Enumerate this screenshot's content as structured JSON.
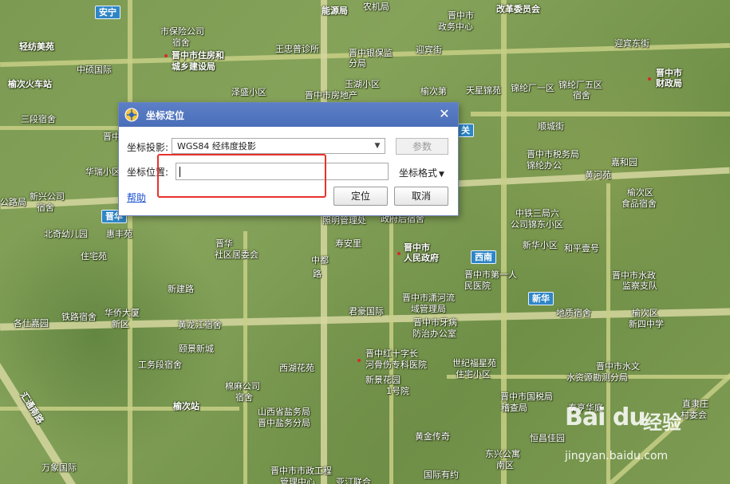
{
  "map": {
    "badges": [
      {
        "text": "安宁",
        "style": "blue"
      },
      {
        "text": "晋华",
        "style": "blue"
      },
      {
        "text": "西南",
        "style": "blue"
      },
      {
        "text": "新华",
        "style": "blue"
      },
      {
        "text": "关",
        "style": "blue"
      }
    ],
    "labels": [
      "市保险公司",
      "宿舍",
      "轻纺美苑",
      "晋中市住房和",
      "城乡建设局",
      "王忠普诊所",
      "晋中银保监",
      "分局",
      "迎宾街",
      "迎宾东街",
      "晋中市",
      "政务中心",
      "能源局",
      "农机局",
      "改革委员会",
      "榆次火车站",
      "中硕国际",
      "泽盛小区",
      "玉湖小区",
      "晋中市房地产",
      "榆次第",
      "天星锦苑",
      "锦纶厂一区",
      "锦纶厂五区",
      "宿舍",
      "晋中市",
      "财政局",
      "三段宿舍",
      "晋中",
      "华瑞小区",
      "顺城街",
      "晋中市税务局",
      "锦纶办公",
      "嘉和园",
      "黄河苑",
      "公路局",
      "新兴公司",
      "宿舍",
      "榆次区",
      "食品宿舍",
      "北奇幼儿园",
      "惠丰苑",
      "照明管理处",
      "政府后宿舍",
      "中铁三局六",
      "公司锦东小区",
      "新华小区",
      "和平壹号",
      "住宅苑",
      "晋华",
      "社区居委会",
      "寿安里",
      "中都",
      "路",
      "晋中市",
      "人民政府",
      "晋中市第一人",
      "民医院",
      "晋中市水政",
      "监察支队",
      "新建路",
      "晋中市潇河流",
      "域管理局",
      "华侨大厦",
      "铁路宿舍",
      "各仕嘉园",
      "新区",
      "黄龙江宿舍",
      "君豪国际",
      "晋中市牙病",
      "防治办公室",
      "地质宿舍",
      "榆次区",
      "新四中学",
      "颐景新城",
      "晋中红十字长",
      "河骨伤专科医院",
      "西湖花苑",
      "世纪福星苑",
      "住宅小区",
      "晋中市水文",
      "水资源勘测分局",
      "工务段宿舍",
      "新景花园",
      "1号院",
      "棉麻公司",
      "宿舍",
      "晋中市国税局",
      "稽查局",
      "榆次站",
      "山西省盐务局",
      "晋中盐务分局",
      "泰亨华庭",
      "直隶庄",
      "村委会",
      "汇通南路",
      "黄金传奇",
      "恒昌佳园",
      "东兴公寓",
      "南区",
      "万象国际",
      "晋中市市政工程",
      "管理中心",
      "国际有约",
      "亚汀联合"
    ]
  },
  "dialog": {
    "title": "坐标定位",
    "close_symbol": "✕",
    "projection_label": "坐标投影:",
    "projection_value": "WGS84 经纬度投影",
    "params_button": "参数",
    "position_label": "坐标位置:",
    "position_value": "",
    "format_menu": "坐标格式",
    "help_link": "帮助",
    "locate_button": "定位",
    "cancel_button": "取消"
  },
  "watermark": {
    "logo": "Bai du",
    "text": "经验",
    "url": "jingyan.baidu.com"
  },
  "colors": {
    "title_bar": "#4a6eb8",
    "highlight": "#e8322c",
    "badge_blue": "#2f86c6",
    "map_green": "#7c9a52"
  }
}
